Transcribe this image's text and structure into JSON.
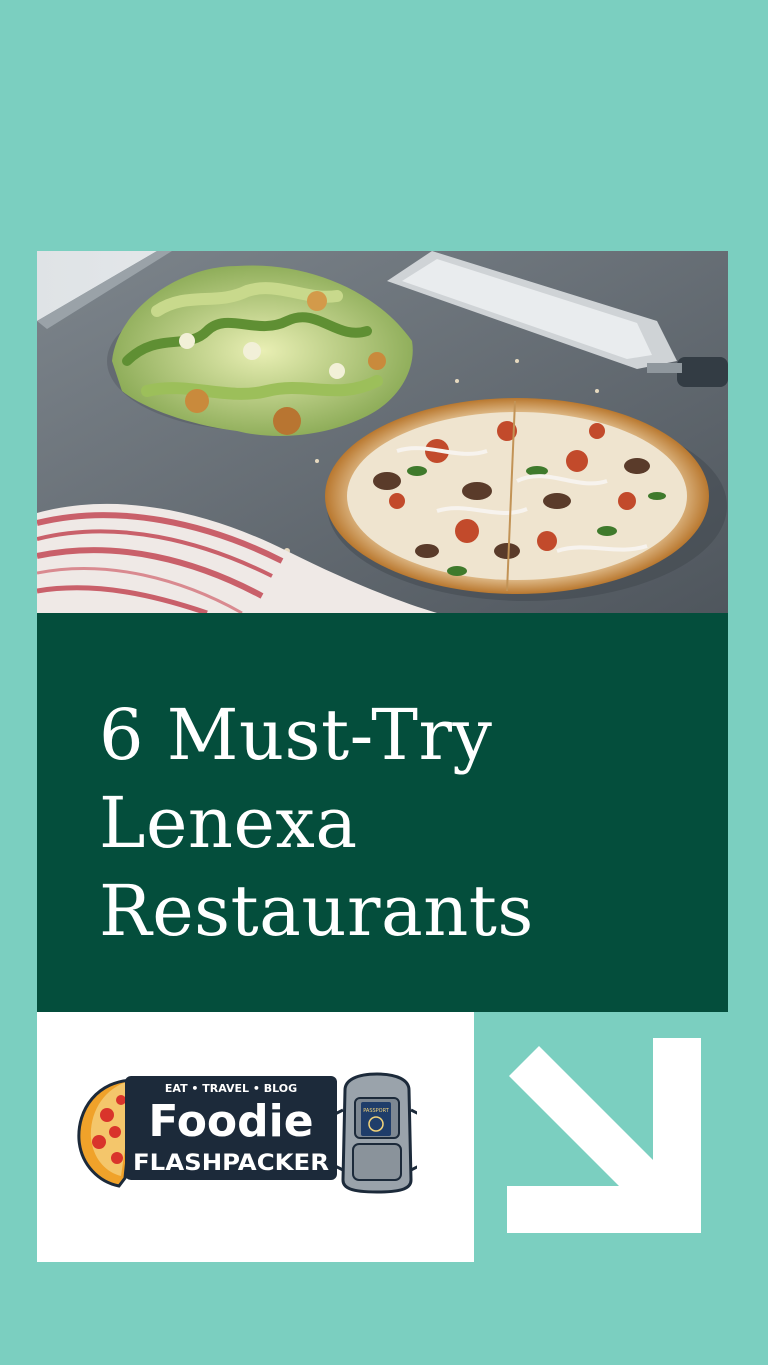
{
  "colors": {
    "background": "#7bcfc0",
    "title_panel": "#044e3c",
    "title_text": "#ffffff",
    "logo_panel": "#ffffff",
    "arrow": "#ffffff",
    "logo_dark": "#1c2a3a"
  },
  "title": {
    "lines": [
      "6 Must-Try",
      "Lenexa",
      "Restaurants"
    ]
  },
  "logo": {
    "tagline": "EAT • TRAVEL • BLOG",
    "word_1": "Foodie",
    "word_2": "FLASHPACKER",
    "passport": "PASSPORT"
  },
  "photo": {
    "subject": "caesar salad and pizza on a serving board"
  },
  "arrow": {
    "icon": "arrow-down-right-icon"
  }
}
